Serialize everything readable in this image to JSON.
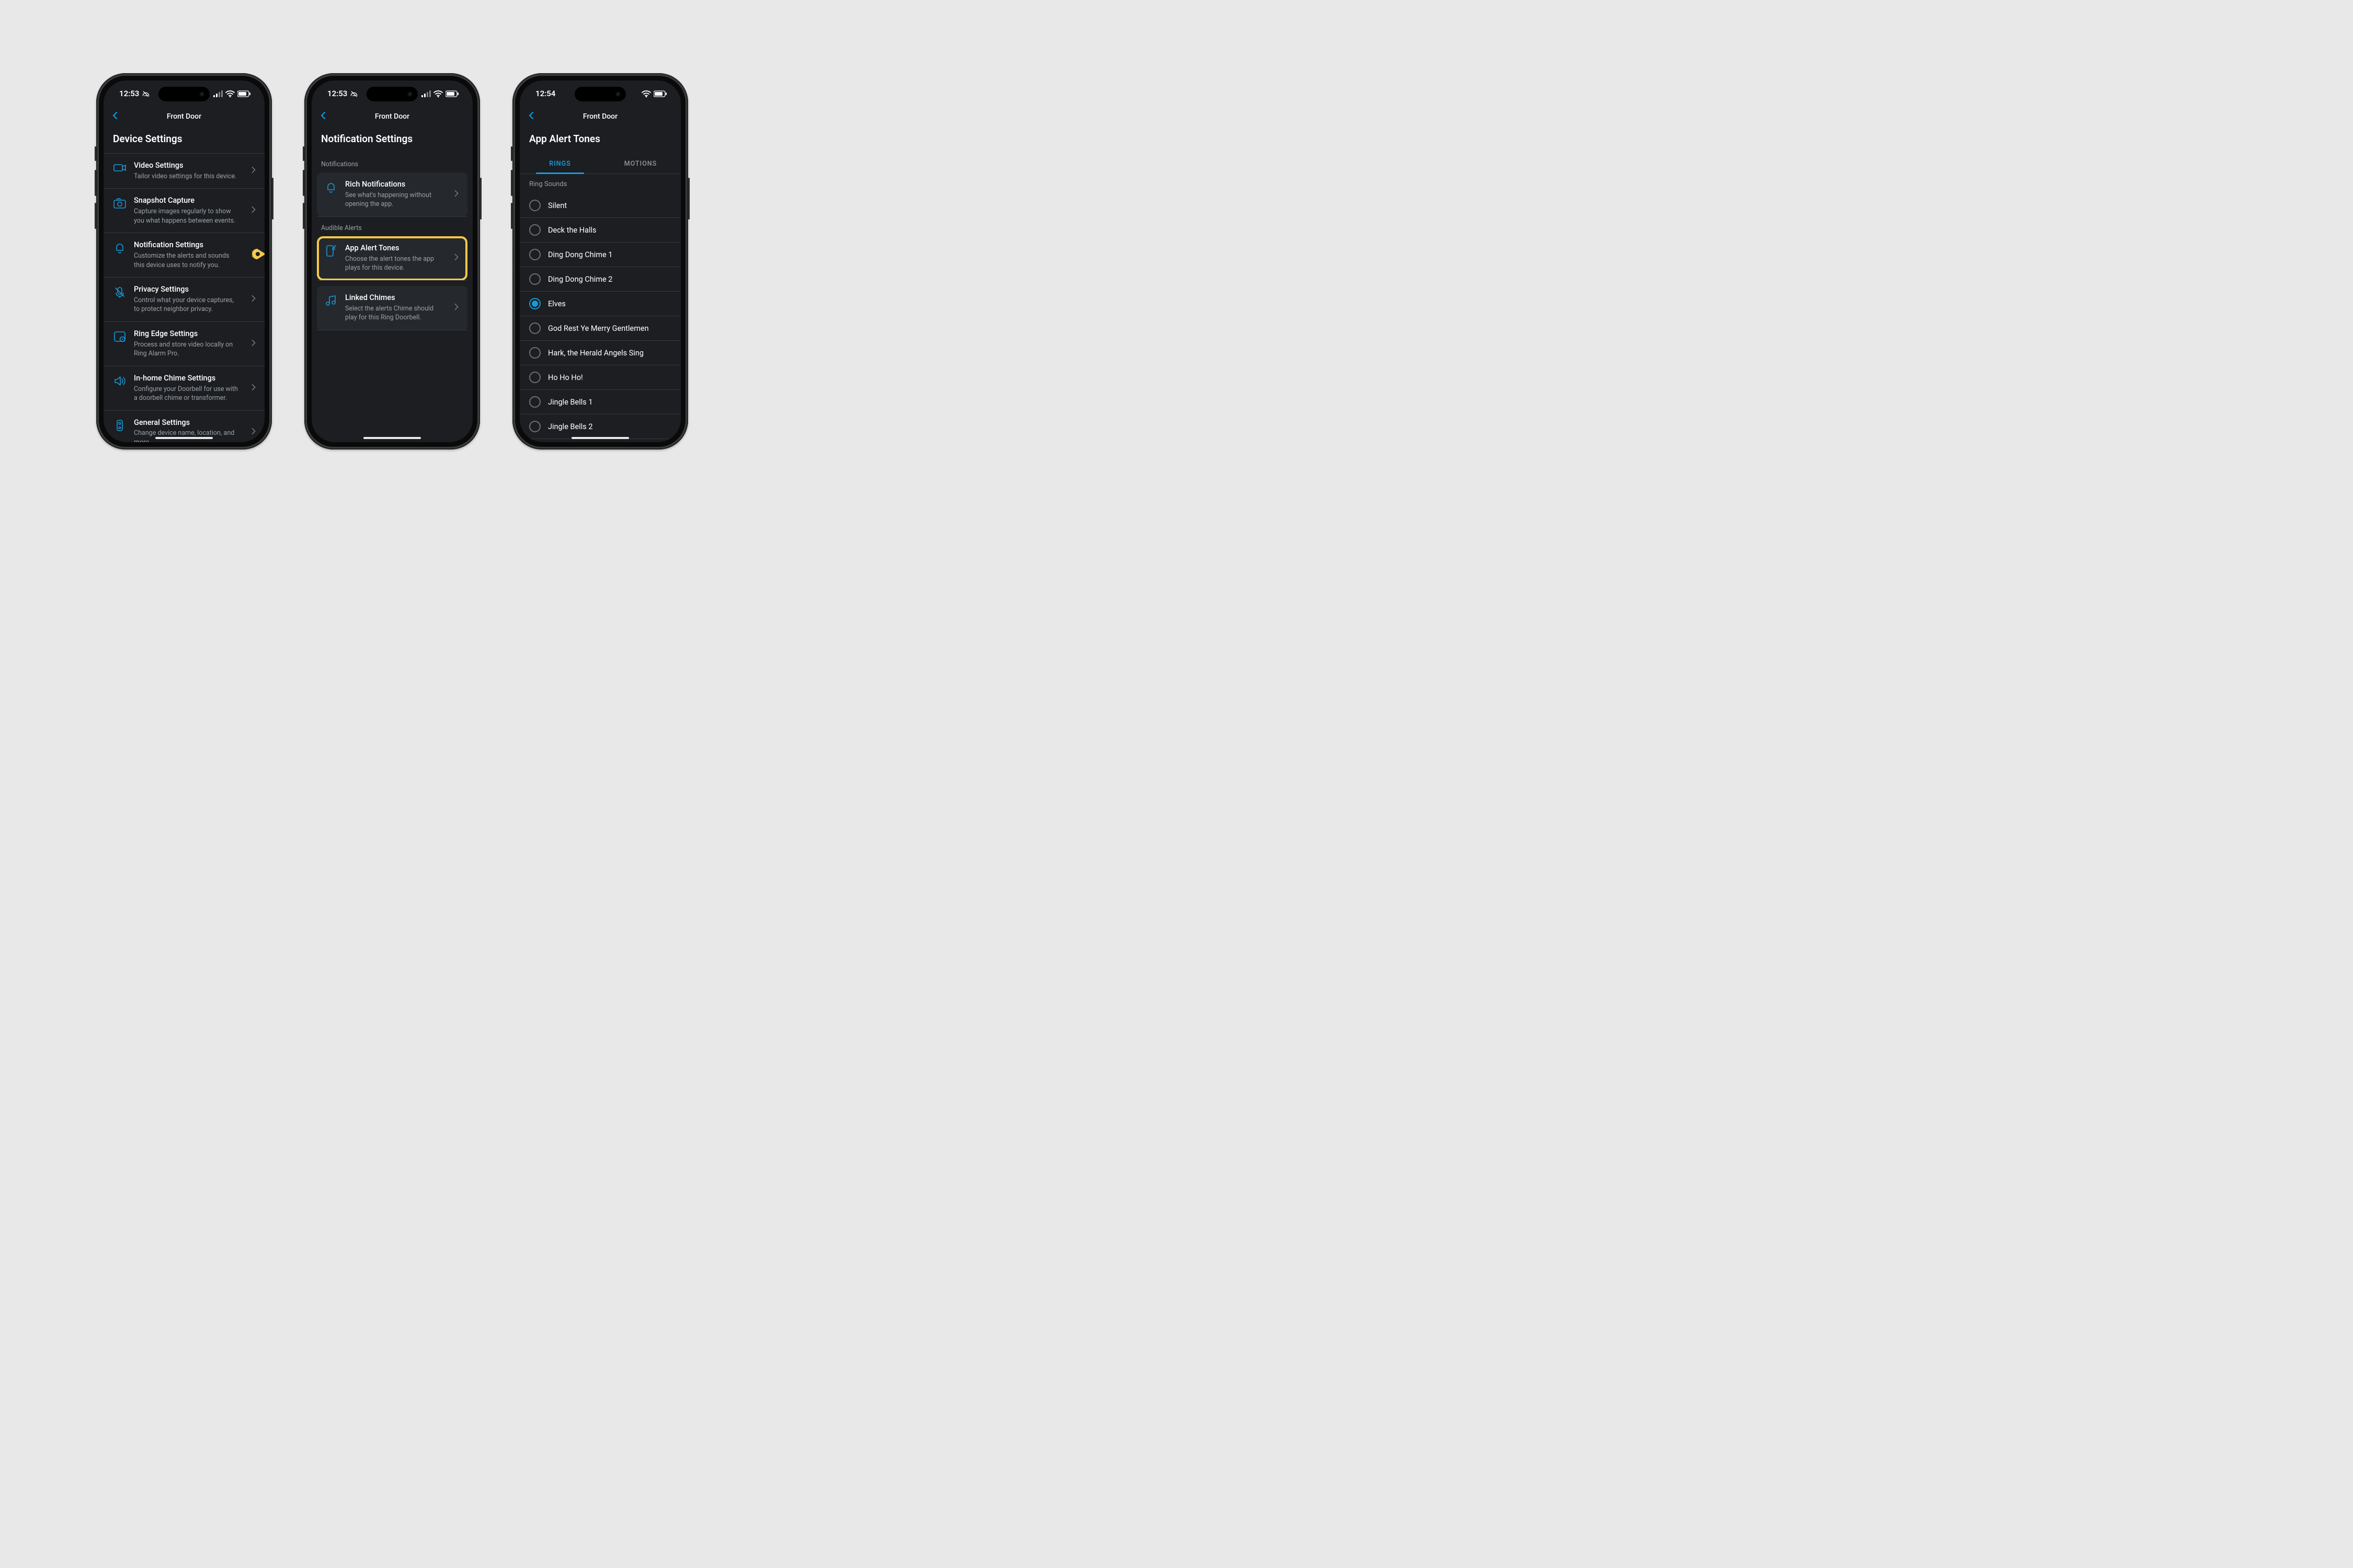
{
  "phones": {
    "left": {
      "status": {
        "time": "12:53",
        "mute": true,
        "signal": true
      },
      "nav_title": "Front Door",
      "page_title": "Device Settings",
      "items": [
        {
          "icon": "video-icon",
          "label": "Video Settings",
          "sub": "Tailor video settings for this device."
        },
        {
          "icon": "camera-icon",
          "label": "Snapshot Capture",
          "sub": "Capture images regularly to show you what happens between events."
        },
        {
          "icon": "bell-icon",
          "label": "Notification Settings",
          "sub": "Customize the alerts and sounds this device uses to notify you.",
          "pointer": true
        },
        {
          "icon": "mic-off-icon",
          "label": "Privacy Settings",
          "sub": "Control what your device captures, to protect neighbor privacy."
        },
        {
          "icon": "storage-icon",
          "label": "Ring Edge Settings",
          "sub": "Process and store video locally on Ring Alarm Pro."
        },
        {
          "icon": "speaker-icon",
          "label": "In-home Chime Settings",
          "sub": "Configure your Doorbell for use with a doorbell chime or transformer."
        },
        {
          "icon": "device-icon",
          "label": "General Settings",
          "sub": "Change device name, location, and more."
        }
      ]
    },
    "middle": {
      "status": {
        "time": "12:53",
        "mute": true,
        "signal": true
      },
      "nav_title": "Front Door",
      "page_title": "Notification Settings",
      "sections": [
        {
          "header": "Notifications",
          "items": [
            {
              "icon": "bell-icon",
              "label": "Rich Notifications",
              "sub": "See what's happening without opening the app."
            }
          ]
        },
        {
          "header": "Audible Alerts",
          "items": [
            {
              "icon": "phone-tone-icon",
              "label": "App Alert Tones",
              "sub": "Choose the alert tones the app plays for this device.",
              "highlight": true
            },
            {
              "icon": "music-icon",
              "label": "Linked Chimes",
              "sub": "Select the alerts Chime should play for this Ring Doorbell."
            }
          ]
        }
      ]
    },
    "right": {
      "status": {
        "time": "12:54",
        "mute": false,
        "signal": false
      },
      "nav_title": "Front Door",
      "page_title": "App Alert Tones",
      "tabs": {
        "active": "RINGS",
        "inactive": "MOTIONS"
      },
      "list_header": "Ring Sounds",
      "selected": "Elves",
      "sounds": [
        "Silent",
        "Deck the Halls",
        "Ding Dong Chime 1",
        "Ding Dong Chime 2",
        "Elves",
        "God Rest Ye Merry Gentlemen",
        "Hark, the Herald Angels Sing",
        "Ho Ho Ho!",
        "Jingle Bells 1",
        "Jingle Bells 2"
      ]
    }
  }
}
